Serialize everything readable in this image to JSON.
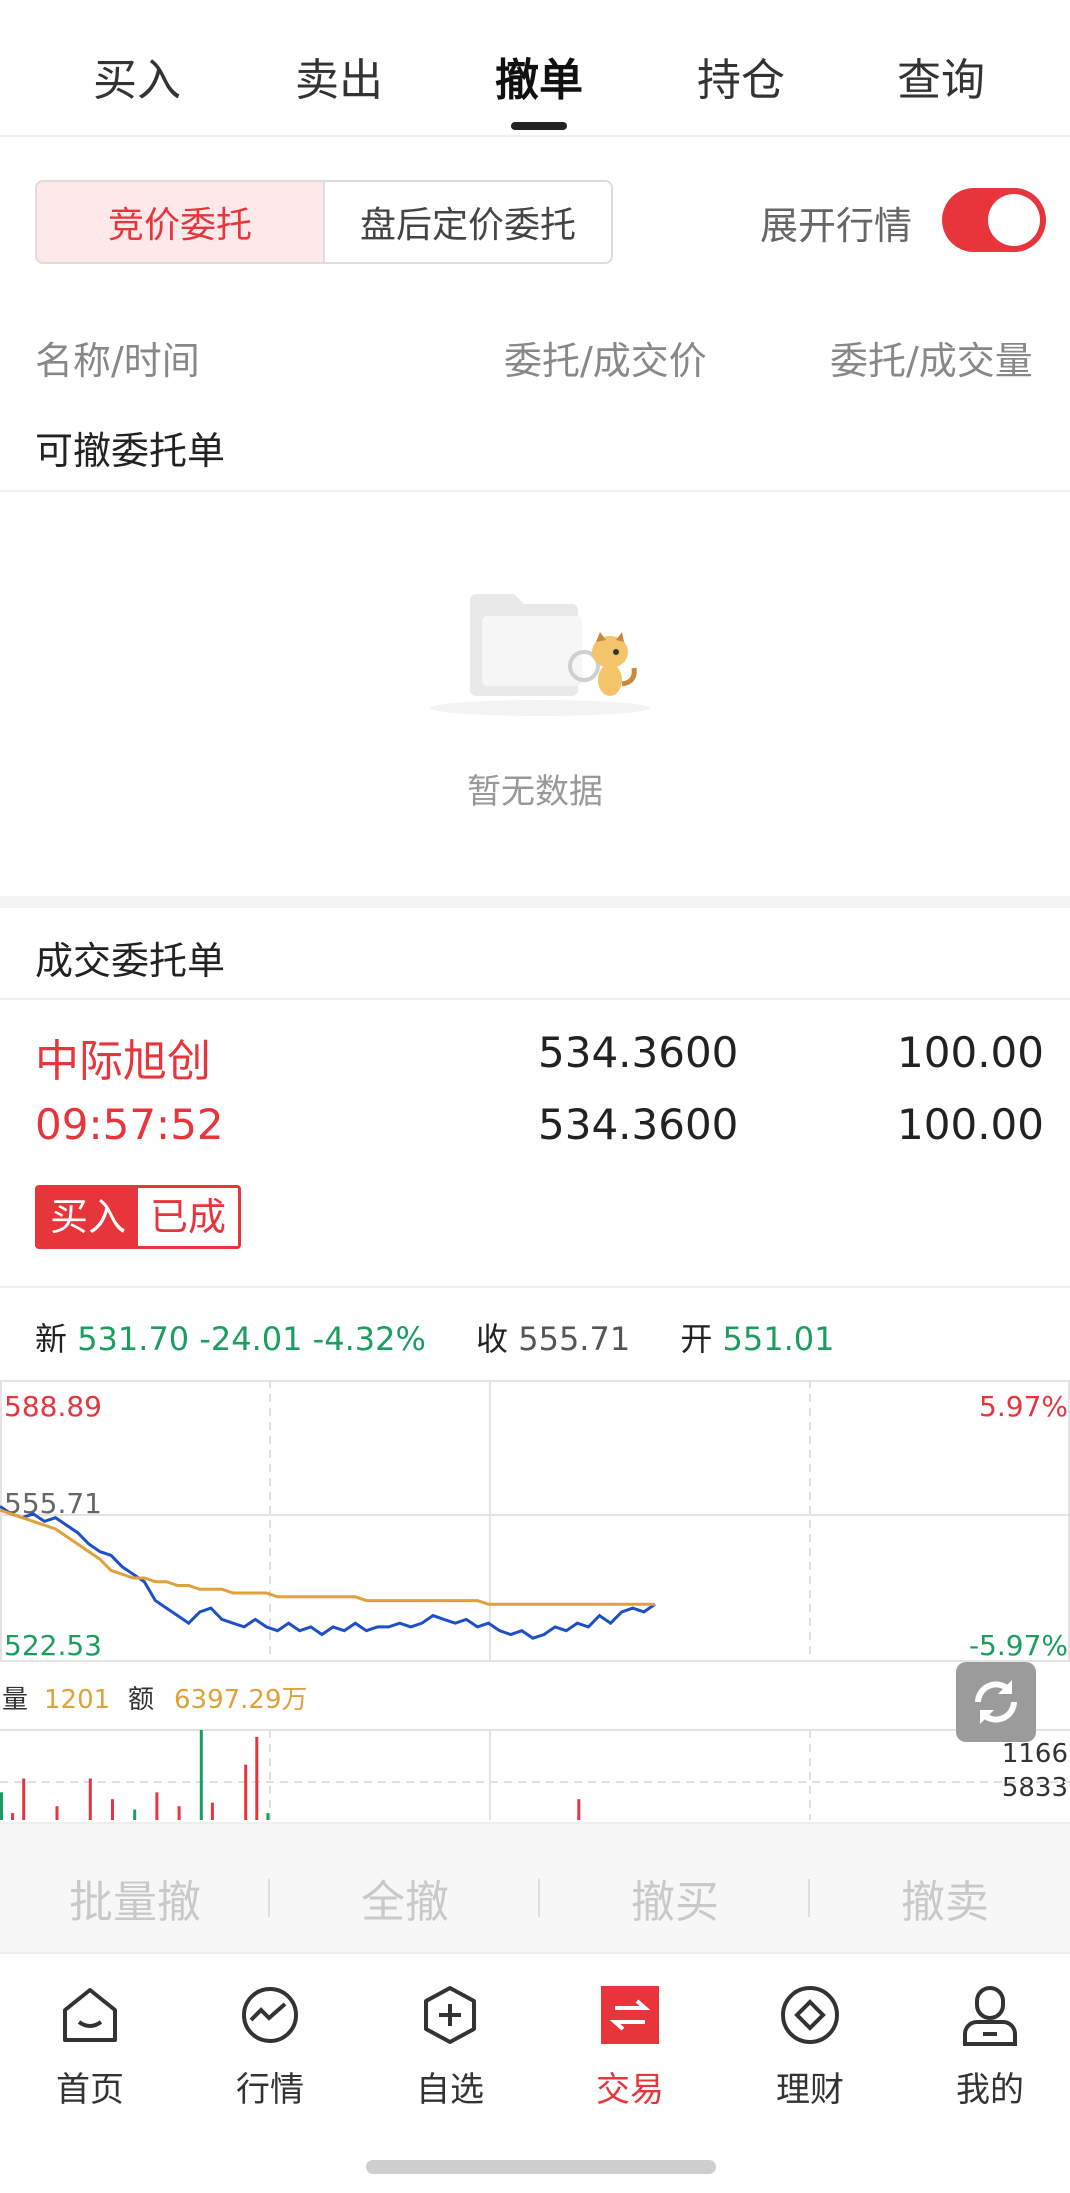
{
  "tabs": [
    "买入",
    "卖出",
    "撤单",
    "持仓",
    "查询"
  ],
  "segment": {
    "active": "竞价委托",
    "inactive": "盘后定价委托"
  },
  "toggle": {
    "label": "展开行情",
    "on": true
  },
  "columns": {
    "name_time": "名称/时间",
    "price": "委托/成交价",
    "qty": "委托/成交量"
  },
  "cancellable": {
    "title": "可撤委托单",
    "empty_text": "暂无数据"
  },
  "filled": {
    "title": "成交委托单",
    "order": {
      "name": "中际旭创",
      "time": "09:57:52",
      "order_price": "534.3600",
      "deal_price": "534.3600",
      "order_qty": "100.00",
      "deal_qty": "100.00",
      "side": "买入",
      "status": "已成"
    }
  },
  "quote": {
    "new_label": "新",
    "new_price": "531.70",
    "change": "-24.01",
    "change_pct": "-4.32%",
    "close_label": "收",
    "close": "555.71",
    "open_label": "开",
    "open": "551.01"
  },
  "chart_data": {
    "type": "line",
    "y_axis_left": [
      "588.89",
      "555.71",
      "522.53"
    ],
    "y_axis_right": [
      "5.97%",
      "-5.97%"
    ],
    "ylim": [
      522.53,
      588.89
    ],
    "series": [
      {
        "color": "#1f4fc4",
        "values": [
          558,
          556,
          555,
          556,
          554,
          555,
          553,
          551,
          548,
          546,
          545,
          542,
          540,
          538,
          533,
          531,
          529,
          527,
          530,
          531,
          528,
          527,
          526,
          528,
          526,
          525,
          527,
          525,
          526,
          524,
          526,
          525,
          527,
          525,
          526,
          526,
          527,
          526,
          527,
          529,
          528,
          527,
          528,
          526,
          527,
          525,
          524,
          525,
          523,
          524,
          526,
          525,
          527,
          526,
          529,
          527,
          530,
          531,
          530,
          532
        ]
      },
      {
        "color": "#e0a13a",
        "values": [
          557,
          556,
          555,
          554,
          553,
          552,
          550,
          548,
          546,
          544,
          541,
          540,
          539,
          539,
          538,
          538,
          537,
          537,
          536,
          536,
          536,
          535,
          535,
          535,
          535,
          534,
          534,
          534,
          534,
          534,
          534,
          534,
          534,
          533,
          533,
          533,
          533,
          533,
          533,
          533,
          533,
          533,
          533,
          533,
          532,
          532,
          532,
          532,
          532,
          532,
          532,
          532,
          532,
          532,
          532,
          532,
          532,
          532,
          532,
          532
        ]
      }
    ],
    "volume_label": "量",
    "volume": "1201",
    "amount_label": "额",
    "amount": "6397.29万",
    "volume_axis": [
      "1166",
      "5833"
    ],
    "volume_bars": [
      40,
      10,
      60,
      0,
      0,
      20,
      0,
      0,
      60,
      0,
      30,
      0,
      15,
      0,
      40,
      0,
      20,
      0,
      130,
      25,
      0,
      0,
      80,
      120,
      10,
      0,
      0,
      0,
      0,
      0,
      0,
      0,
      0,
      0,
      0,
      0,
      0,
      0,
      0,
      0,
      0,
      0,
      0,
      0,
      0,
      0,
      0,
      0,
      0,
      0,
      0,
      0,
      30,
      0,
      0,
      0,
      0,
      0,
      0,
      0
    ]
  },
  "bottom_actions": [
    "批量撤",
    "全撤",
    "撤买",
    "撤卖"
  ],
  "nav": [
    {
      "label": "首页",
      "icon": "home-icon"
    },
    {
      "label": "行情",
      "icon": "market-icon"
    },
    {
      "label": "自选",
      "icon": "watchlist-icon"
    },
    {
      "label": "交易",
      "icon": "trade-icon"
    },
    {
      "label": "理财",
      "icon": "wealth-icon"
    },
    {
      "label": "我的",
      "icon": "profile-icon"
    }
  ]
}
